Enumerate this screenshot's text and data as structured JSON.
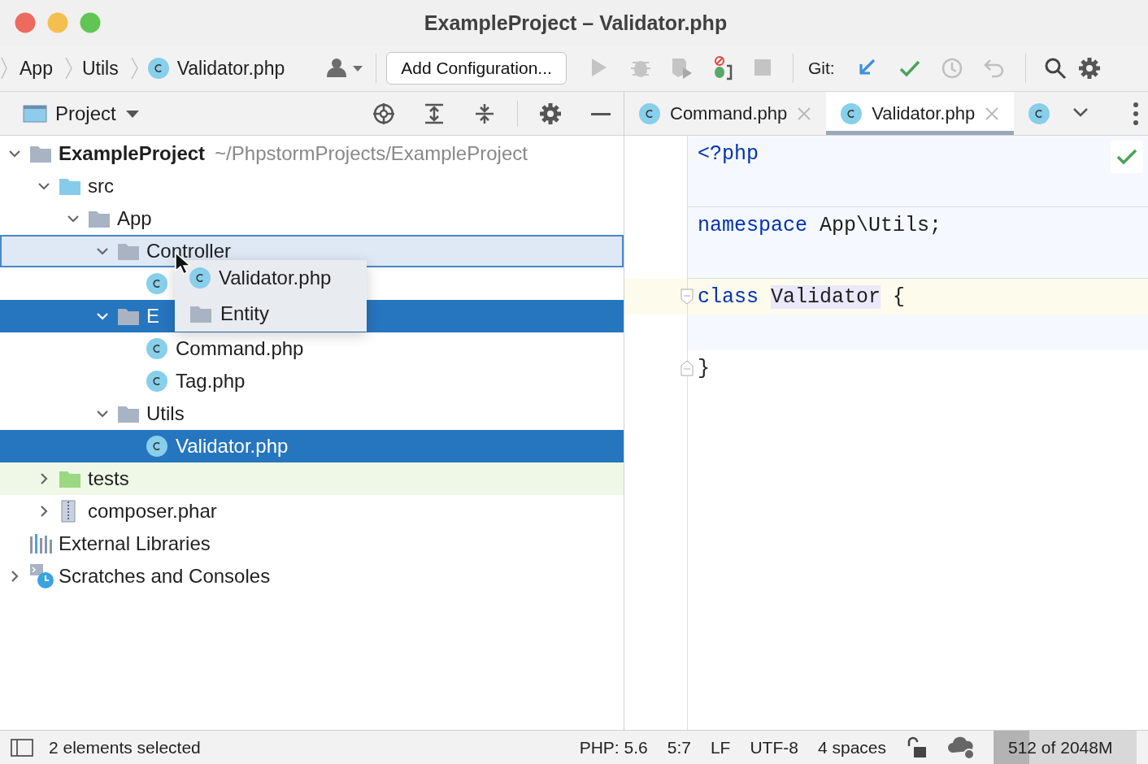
{
  "window": {
    "title": "ExampleProject – Validator.php"
  },
  "breadcrumbs": [
    {
      "label": "App",
      "kind": "namespace"
    },
    {
      "label": "Utils",
      "kind": "namespace"
    },
    {
      "label": "Validator.php",
      "kind": "php-class"
    }
  ],
  "toolbar": {
    "run_config": "Add Configuration...",
    "git_label": "Git:"
  },
  "project_panel": {
    "title": "Project",
    "tree": [
      {
        "label": "ExampleProject",
        "location": "~/PhpstormProjects/ExampleProject",
        "kind": "folder",
        "expanded": true,
        "selected": false,
        "children": [
          {
            "label": "src",
            "kind": "source-folder",
            "expanded": true,
            "selected": false,
            "children": [
              {
                "label": "App",
                "kind": "folder",
                "expanded": true,
                "selected": false,
                "children": [
                  {
                    "label": "Controller",
                    "kind": "folder",
                    "expanded": true,
                    "selected": false,
                    "drop_target": true,
                    "children": [
                      {
                        "kind": "php-class",
                        "selected": false
                      }
                    ]
                  },
                  {
                    "label": "E",
                    "kind": "folder",
                    "expanded": true,
                    "selected": true,
                    "children": [
                      {
                        "label": "Command.php",
                        "kind": "php-class",
                        "selected": false
                      },
                      {
                        "label": "Tag.php",
                        "kind": "php-class",
                        "selected": false
                      }
                    ]
                  },
                  {
                    "label": "Utils",
                    "kind": "folder",
                    "expanded": true,
                    "selected": false,
                    "children": [
                      {
                        "label": "Validator.php",
                        "kind": "php-class",
                        "selected": true
                      }
                    ]
                  }
                ]
              }
            ]
          },
          {
            "label": "tests",
            "kind": "test-folder",
            "expanded": false,
            "selected": false
          },
          {
            "label": "composer.phar",
            "kind": "archive",
            "expanded": false,
            "selected": false
          }
        ]
      },
      {
        "label": "External Libraries",
        "kind": "libraries",
        "selected": false
      },
      {
        "label": "Scratches and Consoles",
        "kind": "scratches",
        "expanded": false,
        "selected": false
      }
    ],
    "drag_preview": [
      {
        "label": "Validator.php",
        "kind": "php-class"
      },
      {
        "label": "Entity",
        "kind": "folder"
      }
    ]
  },
  "editor": {
    "tabs": [
      {
        "label": "Command.php",
        "selected": false
      },
      {
        "label": "Validator.php",
        "selected": true
      },
      {
        "selected": false
      }
    ],
    "inspection_ok": true,
    "lines": [
      {
        "kind": "section",
        "tokens": [
          {
            "text": "<?php",
            "kind": "keyword"
          }
        ]
      },
      {
        "kind": "section-end"
      },
      {
        "kind": "section",
        "tokens": [
          {
            "text": "namespace",
            "kind": "keyword"
          },
          {
            "text": " App\\Utils;",
            "kind": "plain"
          }
        ]
      },
      {
        "kind": "section-end"
      },
      {
        "kind": "class-open",
        "tokens": [
          {
            "text": "class",
            "kind": "keyword"
          },
          {
            "text": "Validator",
            "kind": "class-name"
          },
          {
            "text": " {",
            "kind": "plain"
          }
        ]
      },
      {
        "kind": "section"
      },
      {
        "kind": "class-close",
        "tokens": [
          {
            "text": "}",
            "kind": "plain"
          }
        ]
      }
    ]
  },
  "status_bar": {
    "message": "2 elements selected",
    "items": [
      "PHP: 5.6",
      "5:7",
      "LF",
      "UTF-8",
      "4 spaces"
    ],
    "memory": {
      "text": "512 of 2048M",
      "level": 0.25
    }
  }
}
